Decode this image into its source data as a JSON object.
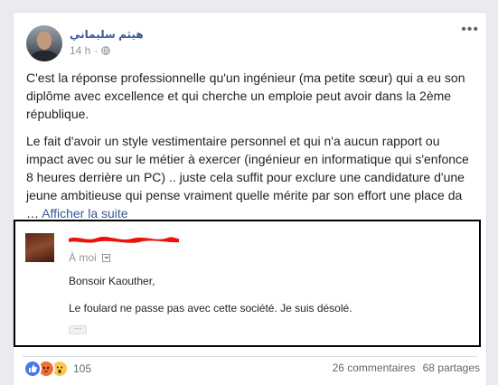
{
  "post": {
    "author": "هيثم سليماني",
    "time": "14 h",
    "more_label": "•••",
    "paragraph1": "C'est la réponse professionnelle qu'un ingénieur (ma petite sœur) qui a eu son diplôme avec excellence et qui cherche un emploie peut avoir dans la 2ème république.",
    "paragraph2": "Le fait d'avoir un style vestimentaire personnel et qui n'a aucun rapport ou impact avec ou sur le métier à exercer (ingénieur en informatique qui s'enfonce 8 heures derrière un PC) .. juste cela suffit pour exclure une candidature d'une jeune ambitieuse qui pense vraiment quelle mérite par son effort une place da",
    "ellipsis": "… ",
    "see_more": "Afficher la suite"
  },
  "embedded_email": {
    "to_label": "À moi",
    "greeting": "Bonsoir Kaouther,",
    "body": "Le foulard ne passe pas avec cette société. Je suis désolé.",
    "more_dots": "···"
  },
  "footer": {
    "reactions_count": "105",
    "comments": "26 commentaires",
    "shares": "68 partages"
  },
  "colors": {
    "link": "#365899",
    "text": "#1d2129",
    "muted": "#90949c",
    "redaction": "#e8150b",
    "like": "#4a76e8",
    "angry": "#f0703a",
    "wow": "#f7c84c"
  },
  "icons": [
    "globe-icon",
    "more-options-icon",
    "dropdown-icon",
    "like-reaction-icon",
    "angry-reaction-icon",
    "wow-reaction-icon"
  ]
}
